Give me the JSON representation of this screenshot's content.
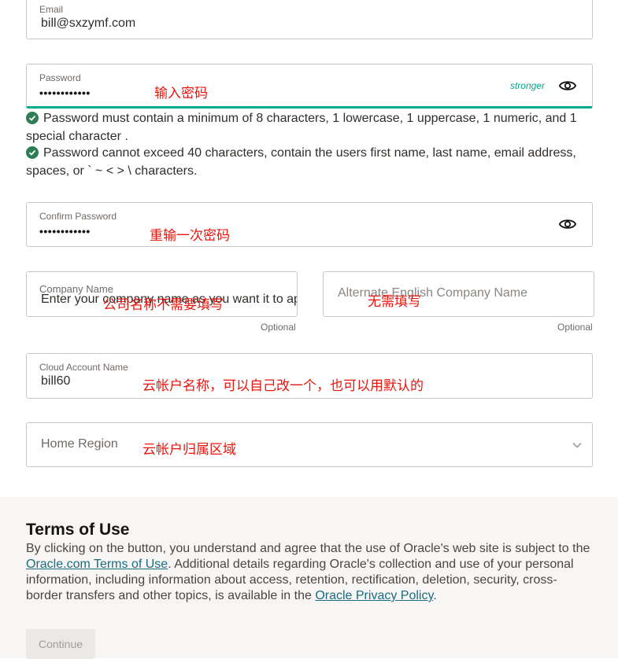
{
  "email": {
    "label": "Email",
    "value": "bill@sxzymf.com"
  },
  "password": {
    "label": "Password",
    "value": "••••••••••••",
    "strength": "stronger",
    "annotation": "输入密码",
    "accent_color": "#00a98f"
  },
  "password_rules": [
    {
      "text": "Password must contain a minimum of 8 characters, 1 lowercase, 1 uppercase, 1 numeric, and 1 special character ."
    },
    {
      "text": "Password cannot exceed 40 characters, contain the users first name, last name, email address, spaces, or ` ~ < > \\ characters."
    }
  ],
  "confirm_password": {
    "label": "Confirm Password",
    "value": "••••••••••••",
    "annotation": "重输一次密码"
  },
  "company_name": {
    "label": "Company Name",
    "placeholder": "Enter your company name as you want it to appear on purchase documents/transactions name",
    "annotation": "公司名称不需要填写",
    "optional": "Optional"
  },
  "alt_company_name": {
    "placeholder": "Alternate English Company Name",
    "annotation": "无需填写",
    "optional": "Optional"
  },
  "cloud_account": {
    "label": "Cloud Account Name",
    "value": "bill60",
    "annotation": "云帐户名称，可以自己改一个，也可以用默认的"
  },
  "home_region": {
    "placeholder": "Home Region",
    "annotation": "云帐户归属区域"
  },
  "terms": {
    "title": "Terms of Use",
    "text_1": "By clicking on the button, you understand and agree that the use of Oracle's web site is subject to the ",
    "link_1": "Oracle.com Terms of Use",
    "text_2": ". Additional details regarding Oracle's collection and use of your personal information, including information about access, retention, rectification, deletion, security, cross-border transfers and other topics, is available in the ",
    "link_2": "Oracle Privacy Policy",
    "text_3": "."
  },
  "continue_label": "Continue",
  "icons": {
    "eye": "eye-icon",
    "check": "check-circle-icon",
    "chevron": "chevron-down-icon"
  }
}
